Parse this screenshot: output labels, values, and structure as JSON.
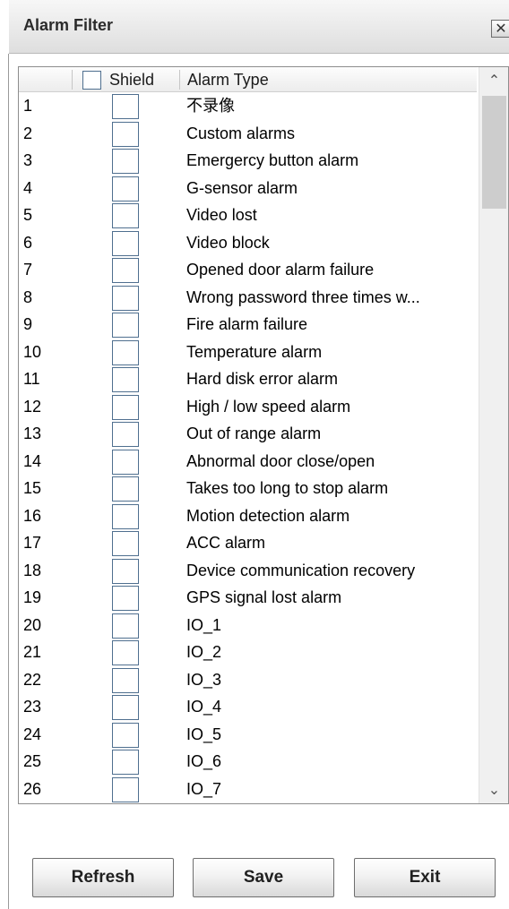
{
  "dialog": {
    "title": "Alarm Filter",
    "close_glyph": "✕",
    "close_icon": "close-icon"
  },
  "table": {
    "columns": {
      "shield": "Shield",
      "alarm_type": "Alarm Type"
    },
    "header_checkbox_checked": false,
    "rows": [
      {
        "num": "1",
        "type": "不录像",
        "checked": false
      },
      {
        "num": "2",
        "type": "Custom alarms",
        "checked": false
      },
      {
        "num": "3",
        "type": "Emergercy button alarm",
        "checked": false
      },
      {
        "num": "4",
        "type": "G-sensor alarm",
        "checked": false
      },
      {
        "num": "5",
        "type": "Video lost",
        "checked": false
      },
      {
        "num": "6",
        "type": "Video block",
        "checked": false
      },
      {
        "num": "7",
        "type": "Opened door alarm failure",
        "checked": false
      },
      {
        "num": "8",
        "type": "Wrong password three times w...",
        "checked": false
      },
      {
        "num": "9",
        "type": "Fire alarm failure",
        "checked": false
      },
      {
        "num": "10",
        "type": "Temperature alarm",
        "checked": false
      },
      {
        "num": "11",
        "type": "Hard disk error alarm",
        "checked": false
      },
      {
        "num": "12",
        "type": "High / low speed alarm",
        "checked": false
      },
      {
        "num": "13",
        "type": "Out of range alarm",
        "checked": false
      },
      {
        "num": "14",
        "type": "Abnormal door close/open",
        "checked": false
      },
      {
        "num": "15",
        "type": "Takes too long to stop alarm",
        "checked": false
      },
      {
        "num": "16",
        "type": "Motion detection alarm",
        "checked": false
      },
      {
        "num": "17",
        "type": "ACC alarm",
        "checked": false
      },
      {
        "num": "18",
        "type": "Device communication recovery",
        "checked": false
      },
      {
        "num": "19",
        "type": "GPS signal lost alarm",
        "checked": false
      },
      {
        "num": "20",
        "type": "IO_1",
        "checked": false
      },
      {
        "num": "21",
        "type": "IO_2",
        "checked": false
      },
      {
        "num": "22",
        "type": "IO_3",
        "checked": false
      },
      {
        "num": "23",
        "type": "IO_4",
        "checked": false
      },
      {
        "num": "24",
        "type": "IO_5",
        "checked": false
      },
      {
        "num": "25",
        "type": "IO_6",
        "checked": false
      },
      {
        "num": "26",
        "type": "IO_7",
        "checked": false
      }
    ]
  },
  "scrollbar": {
    "up_glyph": "⌃",
    "down_glyph": "⌄",
    "position": 0
  },
  "buttons": {
    "refresh": "Refresh",
    "save": "Save",
    "exit": "Exit"
  }
}
